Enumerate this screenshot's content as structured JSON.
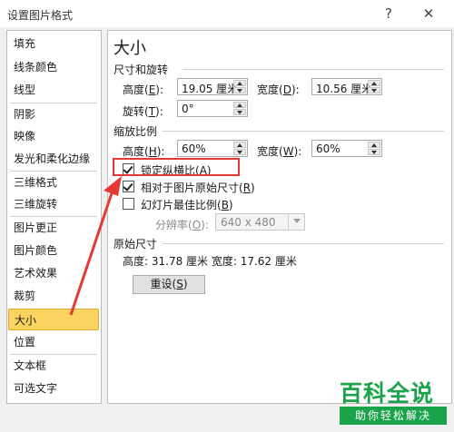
{
  "window": {
    "title": "设置图片格式",
    "help_glyph": "?",
    "close_glyph": "✕"
  },
  "sidebar": {
    "items": [
      {
        "label": "填充"
      },
      {
        "label": "线条颜色"
      },
      {
        "label": "线型"
      },
      {
        "label": "阴影"
      },
      {
        "label": "映像"
      },
      {
        "label": "发光和柔化边缘"
      },
      {
        "label": "三维格式"
      },
      {
        "label": "三维旋转"
      },
      {
        "label": "图片更正"
      },
      {
        "label": "图片颜色"
      },
      {
        "label": "艺术效果"
      },
      {
        "label": "裁剪"
      },
      {
        "label": "大小",
        "selected": true
      },
      {
        "label": "位置"
      },
      {
        "label": "文本框"
      },
      {
        "label": "可选文字"
      }
    ],
    "selected_color": "#fbd35f"
  },
  "panel": {
    "title": "大小",
    "size_rotate": {
      "heading": "尺寸和旋转",
      "height_label": "高度(",
      "height_key": "E",
      "height_value": "19.05 厘米",
      "width_label": "宽度(",
      "width_key": "D",
      "width_value": "10.56 厘米",
      "rotate_label": "旋转(",
      "rotate_key": "T",
      "rotate_value": "0°",
      "paren_close": "):"
    },
    "scale": {
      "heading": "缩放比例",
      "height_label": "高度(",
      "height_key": "H",
      "height_value": "60%",
      "width_label": "宽度(",
      "width_key": "W",
      "width_value": "60%",
      "paren_close": "):",
      "lock_aspect": {
        "label": "锁定纵横比(",
        "key": "A",
        "close": ")",
        "checked": true
      },
      "relative_original": {
        "label": "相对于图片原始尺寸(",
        "key": "R",
        "close": ")",
        "checked": true
      },
      "best_slide": {
        "label": "幻灯片最佳比例(",
        "key": "B",
        "close": ")",
        "checked": false
      },
      "resolution_label": "分辨率(",
      "resolution_key": "O",
      "resolution_close": "):",
      "resolution_value": "640 x 480"
    },
    "original_size": {
      "heading": "原始尺寸",
      "text": "高度:  31.78 厘米   宽度:  17.62 厘米"
    },
    "reset_button": {
      "label": "重设(",
      "key": "S",
      "close": ")"
    }
  },
  "annotation": {
    "color": "#e53935"
  },
  "watermark": {
    "main": "百科全说",
    "sub": "助你轻松解决",
    "color": "#19a34a"
  }
}
